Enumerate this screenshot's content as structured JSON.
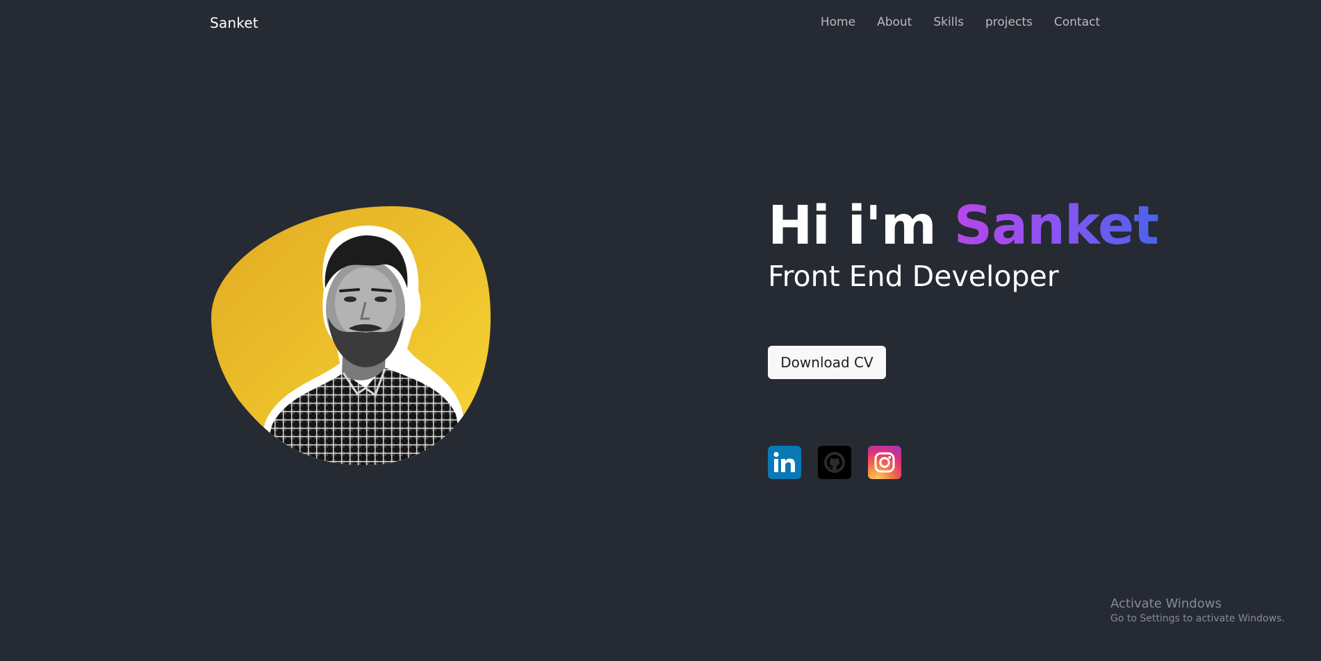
{
  "nav": {
    "brand": "Sanket",
    "links": [
      "Home",
      "About",
      "Skills",
      "projects",
      "Contact"
    ]
  },
  "hero": {
    "greeting": "Hi i'm",
    "name": "Sanket",
    "role": "Front End Developer",
    "download_label": "Download CV"
  },
  "socials": [
    {
      "name": "LinkedIn",
      "icon": "linkedin-icon",
      "color": "#0a78b5"
    },
    {
      "name": "GitHub",
      "icon": "github-icon",
      "color": "#000000"
    },
    {
      "name": "Instagram",
      "icon": "instagram-icon",
      "color": "#e4405f"
    }
  ],
  "colors": {
    "background": "#262a33",
    "blob": "#f2c12e",
    "name_gradient_start": "#b746e8",
    "name_gradient_end": "#4a63ea",
    "nav_text": "#b9bcc4"
  },
  "watermark": {
    "title": "Activate Windows",
    "subtitle": "Go to Settings to activate Windows."
  }
}
